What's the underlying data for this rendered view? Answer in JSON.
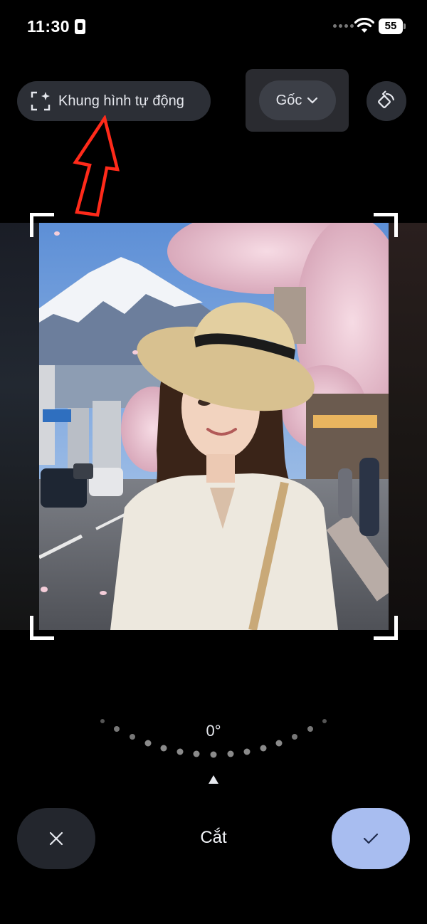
{
  "status_bar": {
    "time": "11:30",
    "battery_level": "55",
    "icons": [
      "sim-icon",
      "signal-dots",
      "wifi-icon",
      "battery-icon"
    ]
  },
  "toolbar": {
    "auto_frame_label": "Khung hình tự động",
    "auto_frame_icon": "auto-frame-sparkle-icon",
    "aspect_label": "Gốc",
    "aspect_icon": "chevron-down-icon",
    "rotate_icon": "rotate-icon"
  },
  "editor": {
    "angle": "0°",
    "title": "Cắt"
  },
  "actions": {
    "cancel_icon": "close-icon",
    "confirm_icon": "check-icon"
  },
  "colors": {
    "background": "#000000",
    "button_bg": "#2c2f36",
    "confirm_bg": "#a8bdf0",
    "annotation_arrow": "#ff2a1a"
  }
}
